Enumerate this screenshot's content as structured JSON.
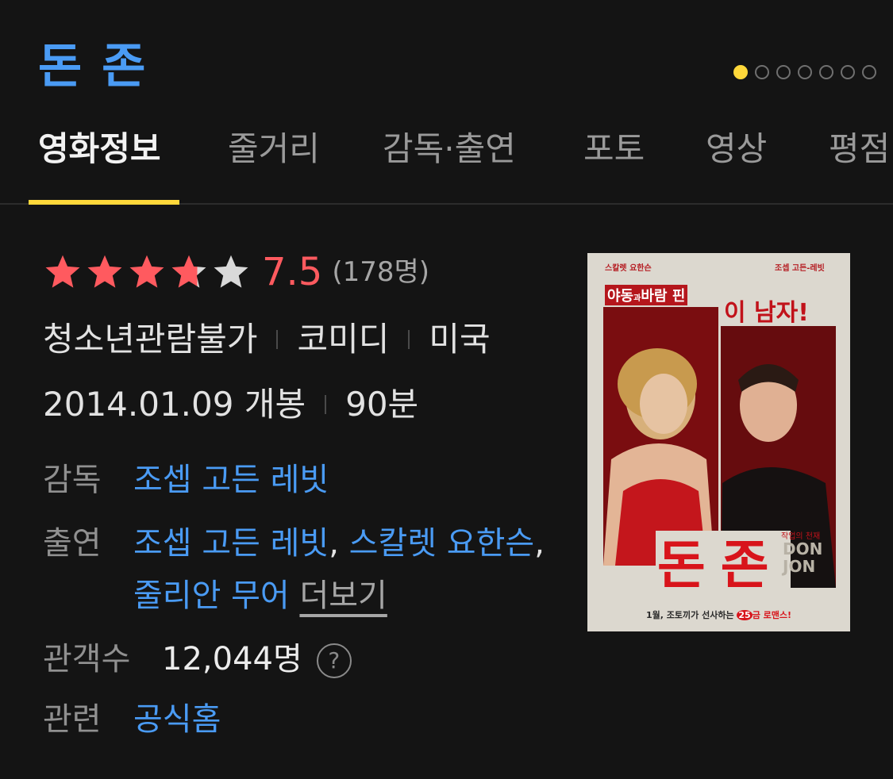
{
  "header": {
    "title": "돈 존"
  },
  "pagination": {
    "count": 7,
    "active_index": 0,
    "active_color": "#ffd83a"
  },
  "tabs": [
    {
      "label": "영화정보",
      "active": true
    },
    {
      "label": "줄거리"
    },
    {
      "label": "감독·출연"
    },
    {
      "label": "포토"
    },
    {
      "label": "영상"
    },
    {
      "label": "평점"
    }
  ],
  "rating": {
    "stars_filled": 3.75,
    "stars_total": 5,
    "value": "7.5",
    "count": "(178명)",
    "color": "#ff5a5f"
  },
  "meta": {
    "grade": "청소년관람불가",
    "genre": "코미디",
    "country": "미국",
    "release": "2014.01.09 개봉",
    "runtime": "90분"
  },
  "info": {
    "director_label": "감독",
    "director": "조셉 고든 레빗",
    "cast_label": "출연",
    "cast": [
      "조셉 고든 레빗",
      "스칼렛 요한슨",
      "줄리안 무어"
    ],
    "cast_comma": ",",
    "more_label": "더보기",
    "audience_label": "관객수",
    "audience": "12,044명",
    "help_icon": "?",
    "related_label": "관련",
    "related_link": "공식홈"
  },
  "poster": {
    "top_left": "스칼렛 요한슨",
    "top_right": "조셉 고든-레빗",
    "tagline_a": "야동",
    "tagline_b": "과",
    "tagline_c": "바람 핀",
    "tagline_d": "이 남자!",
    "title": "돈 존",
    "subtitle": "작업의 천재",
    "title_en": "DON JON",
    "bottom_a": "1월, 조토끼가 선사하는 ",
    "bottom_b": "25",
    "bottom_c": "금 로맨스!"
  },
  "colors": {
    "link": "#4a9bf4",
    "accent": "#ffd83a"
  }
}
